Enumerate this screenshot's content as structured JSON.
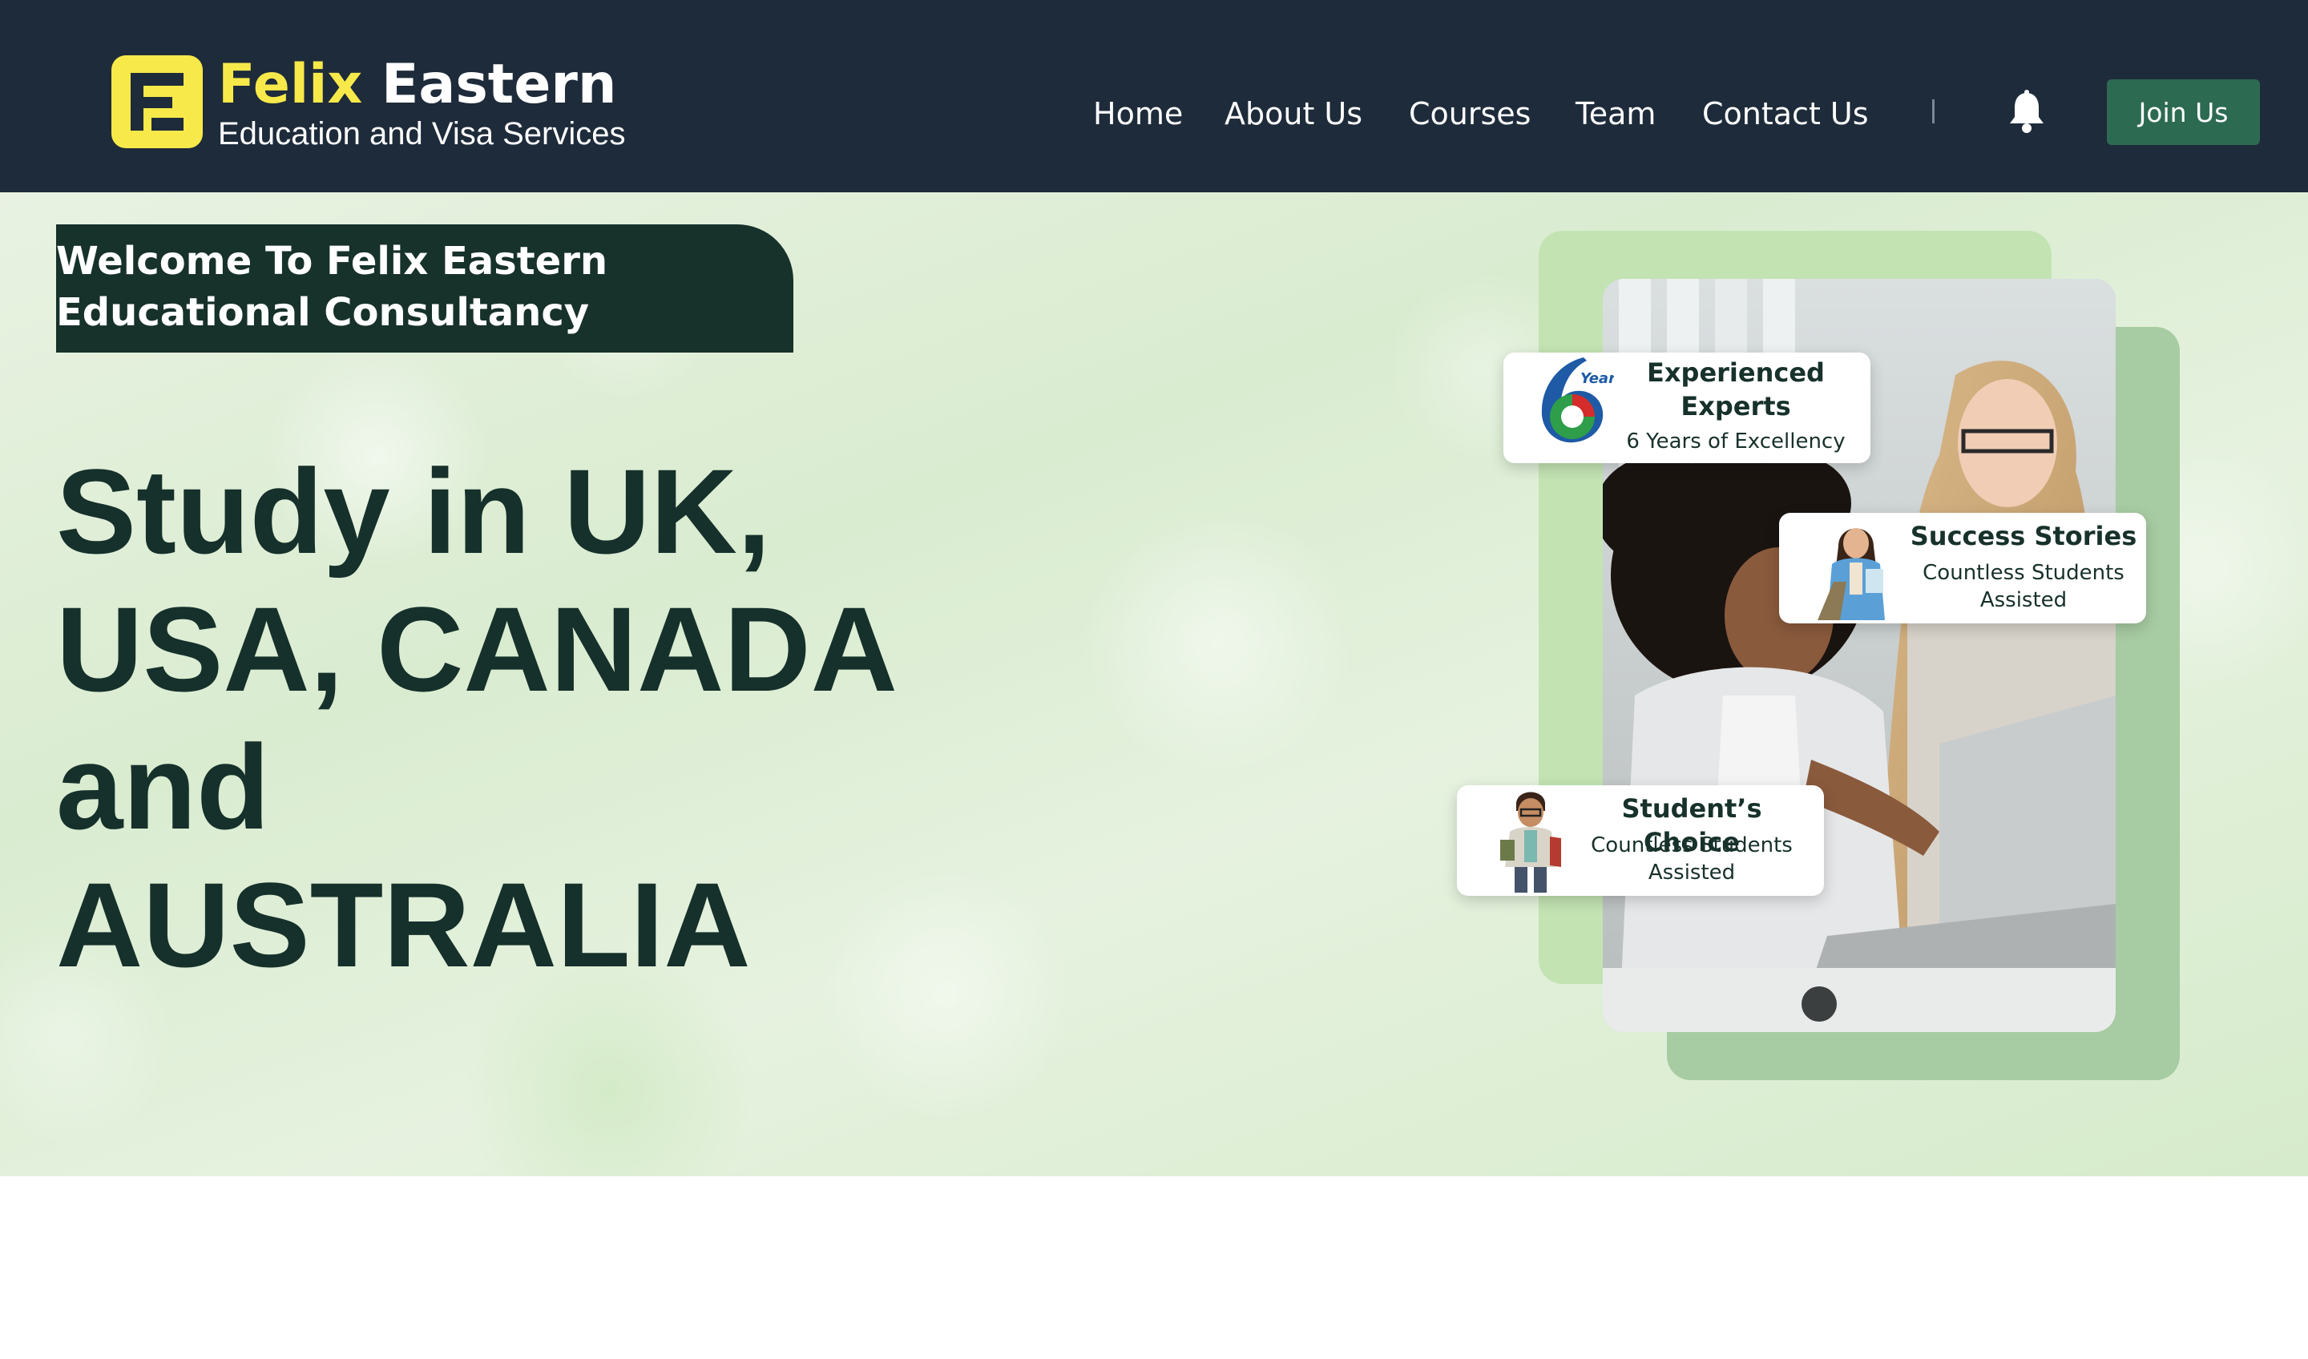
{
  "brand": {
    "name_part1": "Felix",
    "name_part2": "Eastern",
    "tagline": "Education and Visa Services",
    "colors": {
      "nav_bg": "#1e2b3a",
      "accent_yellow": "#f7e94a",
      "button_green": "#2d6a52",
      "dark_green": "#17312b"
    }
  },
  "nav": {
    "items": [
      {
        "label": "Home"
      },
      {
        "label": "About Us"
      },
      {
        "label": "Courses"
      },
      {
        "label": "Team"
      },
      {
        "label": "Contact Us"
      }
    ],
    "separator": "|",
    "bell_icon": "bell-icon",
    "join_label": "Join Us"
  },
  "hero": {
    "welcome": "Welcome To Felix Eastern Educational Consultancy",
    "headline_lines": [
      "Study in UK,",
      "USA, CANADA",
      "and",
      "AUSTRALIA"
    ],
    "cards": [
      {
        "title": "Experienced Experts",
        "subtitle": "6 Years of Excellency",
        "badge_text": "Year",
        "icon": "six-years-badge-icon"
      },
      {
        "title": "Success Stories",
        "subtitle": "Countless Students Assisted",
        "icon": "student-woman-icon"
      },
      {
        "title": "Student’s Choice",
        "subtitle": "Countless Students Assisted",
        "icon": "student-man-icon"
      }
    ]
  }
}
